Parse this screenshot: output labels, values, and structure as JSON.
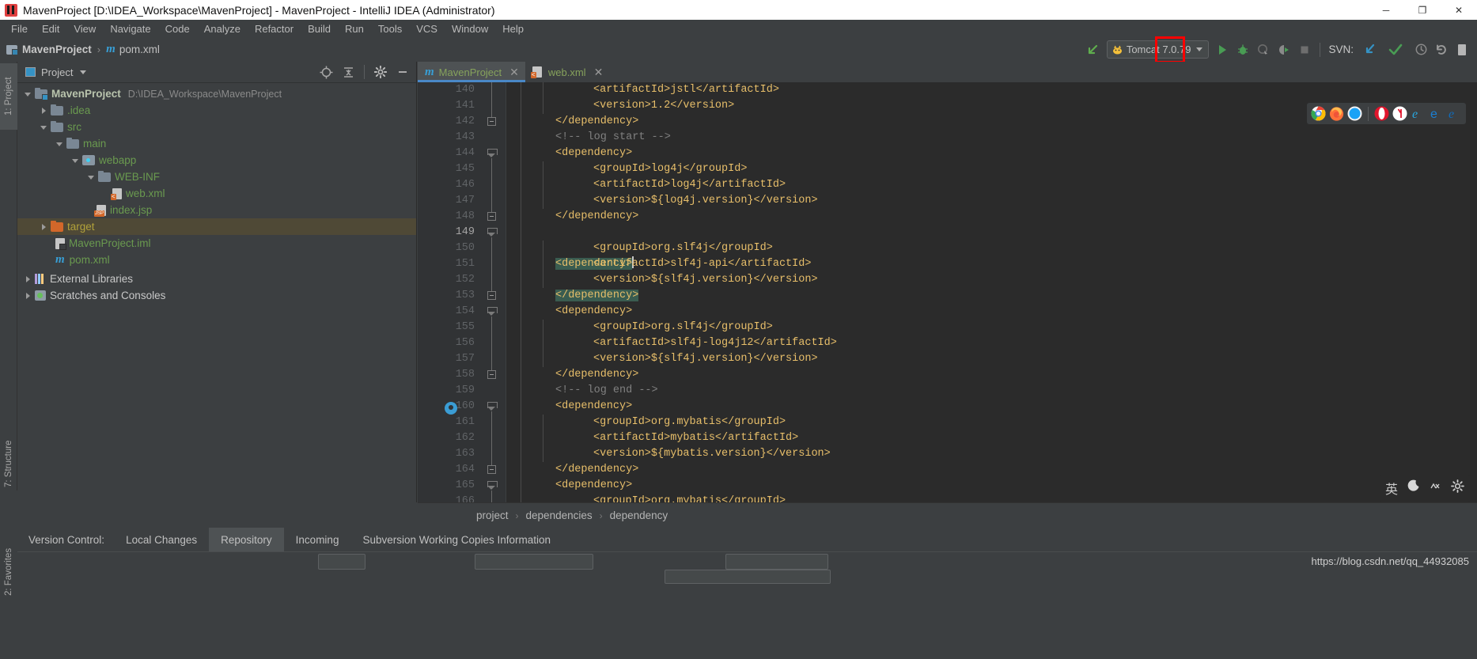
{
  "window": {
    "title": "MavenProject [D:\\IDEA_Workspace\\MavenProject] - MavenProject - IntelliJ IDEA (Administrator)",
    "icon": "intellij-idea-icon",
    "minimize": "─",
    "maximize": "❐",
    "close": "✕"
  },
  "menubar": {
    "items": [
      {
        "label": "File"
      },
      {
        "label": "Edit"
      },
      {
        "label": "View"
      },
      {
        "label": "Navigate"
      },
      {
        "label": "Code"
      },
      {
        "label": "Analyze"
      },
      {
        "label": "Refactor"
      },
      {
        "label": "Build"
      },
      {
        "label": "Run"
      },
      {
        "label": "Tools"
      },
      {
        "label": "VCS"
      },
      {
        "label": "Window"
      },
      {
        "label": "Help"
      }
    ]
  },
  "navbar": {
    "project_crumb": "MavenProject",
    "separator": "›",
    "file_crumb": "pom.xml",
    "file_icon": "maven-m-icon"
  },
  "toolbar": {
    "back_arrow_icon": "green-arrow-icon",
    "run_config": {
      "icon": "tomcat-cat-icon",
      "label": "Tomcat 7.0.79",
      "dropdown_icon": "chevron-down-icon"
    },
    "run_icon": "run-play-icon",
    "debug_icon": "debug-bug-icon",
    "coverage_icon": "run-with-coverage-icon",
    "profile_icon": "profile-icon",
    "stop_icon": "stop-square-icon",
    "svn_label": "SVN:",
    "svn_update_icon": "update-blue-arrow-icon",
    "svn_commit_icon": "commit-green-check-icon",
    "svn_history_icon": "history-clock-icon",
    "svn_rollback_icon": "rollback-undo-icon",
    "extra_icon": "doc-icon",
    "annotation": {
      "type": "red-highlight-box-with-arrow",
      "color": "#ff0000",
      "target": "commit-green-check-icon"
    }
  },
  "left_strip": {
    "tabs": [
      {
        "label": "1: Project",
        "active": true,
        "icon": "project-tool-icon"
      },
      {
        "label": "7: Structure",
        "active": false,
        "icon": "structure-tool-icon"
      },
      {
        "label": "2: Favorites",
        "active": false,
        "icon": "favorites-tool-icon"
      }
    ]
  },
  "project_panel": {
    "title": "Project",
    "title_icon": "project-view-icon",
    "dropdown_icon": "chevron-down-icon",
    "header_icons": [
      {
        "name": "locate-target-icon"
      },
      {
        "name": "collapse-all-icon"
      },
      {
        "name": "settings-gear-icon"
      },
      {
        "name": "hide-minus-icon"
      }
    ],
    "tree": [
      {
        "depth": 0,
        "arrow": "open",
        "icon": "module-folder-icon",
        "name": "MavenProject",
        "path": "D:\\IDEA_Workspace\\MavenProject",
        "style": "root"
      },
      {
        "depth": 1,
        "arrow": "closed",
        "icon": "folder-icon",
        "name": ".idea",
        "path": "",
        "style": "normal"
      },
      {
        "depth": 1,
        "arrow": "open",
        "icon": "folder-icon",
        "name": "src",
        "path": "",
        "style": "normal"
      },
      {
        "depth": 2,
        "arrow": "open",
        "icon": "folder-icon",
        "name": "main",
        "path": "",
        "style": "normal"
      },
      {
        "depth": 3,
        "arrow": "open",
        "icon": "webapp-folder-icon",
        "name": "webapp",
        "path": "",
        "style": "normal"
      },
      {
        "depth": 4,
        "arrow": "open",
        "icon": "folder-icon",
        "name": "WEB-INF",
        "path": "",
        "style": "normal"
      },
      {
        "depth": 5,
        "arrow": "none",
        "icon": "xml-file-icon",
        "name": "web.xml",
        "path": "",
        "style": "normal"
      },
      {
        "depth": 4,
        "arrow": "none",
        "icon": "jsp-file-icon",
        "name": "index.jsp",
        "path": "",
        "style": "normal"
      },
      {
        "depth": 1,
        "arrow": "closed",
        "icon": "folder-orange-icon",
        "name": "target",
        "path": "",
        "style": "selected"
      },
      {
        "depth": 1,
        "arrow": "none",
        "icon": "iml-file-icon",
        "name": "MavenProject.iml",
        "path": "",
        "style": "normal"
      },
      {
        "depth": 1,
        "arrow": "none",
        "icon": "maven-m-icon",
        "name": "pom.xml",
        "path": "",
        "style": "normal"
      },
      {
        "depth": 0,
        "arrow": "closed",
        "icon": "library-icon",
        "name": "External Libraries",
        "path": "",
        "style": "plain"
      },
      {
        "depth": 0,
        "arrow": "closed",
        "icon": "scratches-icon",
        "name": "Scratches and Consoles",
        "path": "",
        "style": "plain"
      }
    ]
  },
  "editor": {
    "tabs": [
      {
        "label": "MavenProject",
        "icon": "maven-m-icon",
        "active": true,
        "close_icon": "✕"
      },
      {
        "label": "web.xml",
        "icon": "xml-file-icon",
        "active": false,
        "close_icon": "✕"
      }
    ],
    "first_line_number": 140,
    "lines": [
      {
        "n": 140,
        "indent": 4,
        "text": "<artifactId>jstl</artifactId>",
        "kind": "tag",
        "fold": "none",
        "highlight": false
      },
      {
        "n": 141,
        "indent": 4,
        "text": "<version>1.2</version>",
        "kind": "tag",
        "fold": "none",
        "highlight": false
      },
      {
        "n": 142,
        "indent": 2,
        "text": "</dependency>",
        "kind": "tag",
        "fold": "end",
        "highlight": false
      },
      {
        "n": 143,
        "indent": 2,
        "text": "<!-- log start -->",
        "kind": "comment",
        "fold": "none",
        "highlight": false
      },
      {
        "n": 144,
        "indent": 2,
        "text": "<dependency>",
        "kind": "tag",
        "fold": "start",
        "highlight": false
      },
      {
        "n": 145,
        "indent": 4,
        "text": "<groupId>log4j</groupId>",
        "kind": "tag",
        "fold": "none",
        "highlight": false
      },
      {
        "n": 146,
        "indent": 4,
        "text": "<artifactId>log4j</artifactId>",
        "kind": "tag",
        "fold": "none",
        "highlight": false
      },
      {
        "n": 147,
        "indent": 4,
        "text": "<version>${log4j.version}</version>",
        "kind": "tag",
        "fold": "none",
        "highlight": false
      },
      {
        "n": 148,
        "indent": 2,
        "text": "</dependency>",
        "kind": "tag",
        "fold": "end",
        "highlight": false
      },
      {
        "n": 149,
        "indent": 2,
        "text": "<dependency>",
        "kind": "tag",
        "fold": "start",
        "highlight": true,
        "cursor": true
      },
      {
        "n": 150,
        "indent": 4,
        "text": "<groupId>org.slf4j</groupId>",
        "kind": "tag",
        "fold": "none",
        "highlight": false
      },
      {
        "n": 151,
        "indent": 4,
        "text": "<artifactId>slf4j-api</artifactId>",
        "kind": "tag",
        "fold": "none",
        "highlight": false
      },
      {
        "n": 152,
        "indent": 4,
        "text": "<version>${slf4j.version}</version>",
        "kind": "tag",
        "fold": "none",
        "highlight": false
      },
      {
        "n": 153,
        "indent": 2,
        "text": "</dependency>",
        "kind": "tag",
        "fold": "end",
        "highlight": true
      },
      {
        "n": 154,
        "indent": 2,
        "text": "<dependency>",
        "kind": "tag",
        "fold": "start",
        "highlight": false
      },
      {
        "n": 155,
        "indent": 4,
        "text": "<groupId>org.slf4j</groupId>",
        "kind": "tag",
        "fold": "none",
        "highlight": false
      },
      {
        "n": 156,
        "indent": 4,
        "text": "<artifactId>slf4j-log4j12</artifactId>",
        "kind": "tag",
        "fold": "none",
        "highlight": false
      },
      {
        "n": 157,
        "indent": 4,
        "text": "<version>${slf4j.version}</version>",
        "kind": "tag",
        "fold": "none",
        "highlight": false
      },
      {
        "n": 158,
        "indent": 2,
        "text": "</dependency>",
        "kind": "tag",
        "fold": "end",
        "highlight": false
      },
      {
        "n": 159,
        "indent": 2,
        "text": "<!-- log end -->",
        "kind": "comment",
        "fold": "none",
        "highlight": false
      },
      {
        "n": 160,
        "indent": 2,
        "text": "<dependency>",
        "kind": "tag",
        "fold": "start",
        "highlight": false,
        "runmark": true
      },
      {
        "n": 161,
        "indent": 4,
        "text": "<groupId>org.mybatis</groupId>",
        "kind": "tag",
        "fold": "none",
        "highlight": false
      },
      {
        "n": 162,
        "indent": 4,
        "text": "<artifactId>mybatis</artifactId>",
        "kind": "tag",
        "fold": "none",
        "highlight": false
      },
      {
        "n": 163,
        "indent": 4,
        "text": "<version>${mybatis.version}</version>",
        "kind": "tag",
        "fold": "none",
        "highlight": false
      },
      {
        "n": 164,
        "indent": 2,
        "text": "</dependency>",
        "kind": "tag",
        "fold": "end",
        "highlight": false
      },
      {
        "n": 165,
        "indent": 2,
        "text": "<dependency>",
        "kind": "tag",
        "fold": "start",
        "highlight": false
      },
      {
        "n": 166,
        "indent": 4,
        "text": "<groupId>org.mybatis</groupId>",
        "kind": "tag",
        "fold": "none",
        "highlight": false
      }
    ],
    "breadcrumb": [
      "project",
      "dependencies",
      "dependency"
    ],
    "breadcrumb_sep": "›"
  },
  "browser_bar": {
    "icons": [
      {
        "name": "chrome-icon",
        "color": "#4285f4"
      },
      {
        "name": "firefox-icon",
        "color": "#ff7139"
      },
      {
        "name": "safari-icon",
        "color": "#1ba2f6"
      },
      {
        "name": "opera-icon",
        "color": "#e0152c"
      },
      {
        "name": "yandex-icon",
        "color": "#ffffff"
      },
      {
        "name": "internet-explorer-icon",
        "color": "#29a8e0"
      },
      {
        "name": "edge-icon",
        "color": "#1a7fd4"
      },
      {
        "name": "edge-legacy-icon",
        "color": "#0f6cbd"
      }
    ]
  },
  "ime": {
    "lang_label": "英",
    "moon_icon": "moon-icon",
    "tray_icon": "tray-icon",
    "gear_icon": "gear-icon"
  },
  "bottom_tool_window": {
    "label": "Version Control:",
    "tabs": [
      {
        "label": "Local Changes",
        "active": false
      },
      {
        "label": "Repository",
        "active": true
      },
      {
        "label": "Incoming",
        "active": false
      },
      {
        "label": "Subversion Working Copies Information",
        "active": false
      }
    ]
  },
  "watermark": "https://blog.csdn.net/qq_44932085",
  "colors": {
    "background": "#3c3f41",
    "editor_background": "#2b2b2b",
    "gutter": "#313335",
    "accent_blue": "#4a88c7",
    "tag_orange": "#e8bf6a",
    "selection_teal": "#3a5c50",
    "tree_green": "#6a9a4f",
    "selected_row": "#4f4936",
    "annotation_red": "#ff0000"
  }
}
